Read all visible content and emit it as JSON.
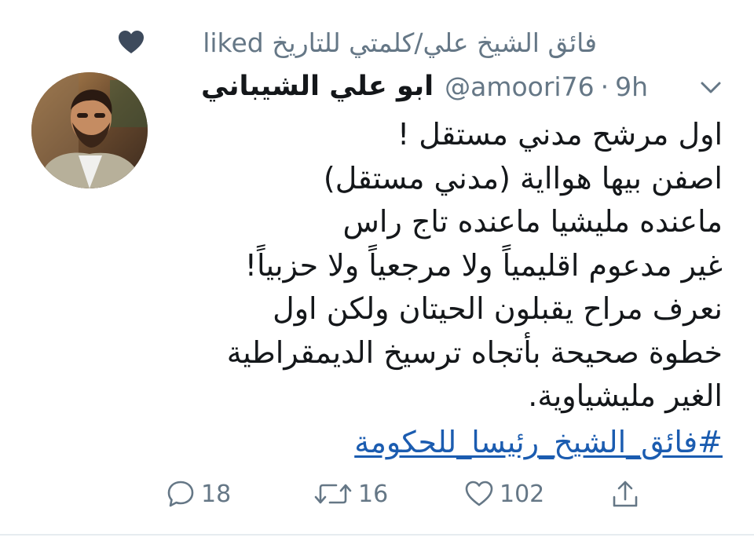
{
  "social_context": {
    "text": "فائق الشيخ علي/كلمتي للتاريخ liked",
    "icon": "heart-icon"
  },
  "author": {
    "display_name": "ابو علي الشيباني",
    "handle": "@amoori76",
    "separator": "·",
    "time": "9h"
  },
  "tweet": {
    "lines": [
      "اول مرشح مدني مستقل !",
      "اصفن بيها هوااية (مدني مستقل)",
      "ماعنده مليشيا ماعنده تاج راس",
      "غير مدعوم اقليمياً ولا مرجعياً ولا حزبياً!",
      "نعرف مراح يقبلون الحيتان ولكن اول",
      "خطوة صحيحة بأتجاه ترسيخ الديمقراطية",
      "الغير مليشياوية."
    ],
    "hashtag": "#فائق_الشيخ_رئيسا_للحكومة"
  },
  "actions": {
    "reply_count": "18",
    "retweet_count": "16",
    "like_count": "102"
  },
  "colors": {
    "text": "#14171a",
    "muted": "#657786",
    "link": "#1b5cb0",
    "icon_dark": "#3d4a5c"
  }
}
